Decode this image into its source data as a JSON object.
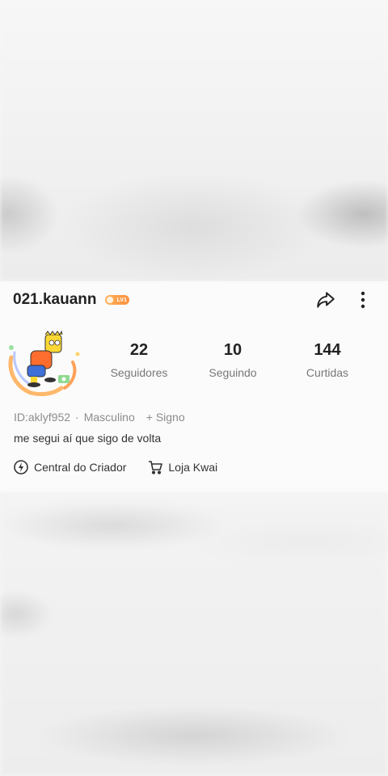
{
  "profile": {
    "username": "021.kauann",
    "level_badge": "LV1",
    "id_text": "ID:aklyf952",
    "id_separator": "·",
    "gender": "Masculino",
    "sign_action": "+ Signo",
    "bio": "me segui aí que sigo de volta"
  },
  "stats": [
    {
      "value": "22",
      "label": "Seguidores"
    },
    {
      "value": "10",
      "label": "Seguindo"
    },
    {
      "value": "144",
      "label": "Curtidas"
    }
  ],
  "links": [
    {
      "label": "Central do Criador",
      "icon": "lightning-icon"
    },
    {
      "label": "Loja Kwai",
      "icon": "cart-icon"
    }
  ],
  "header_icons": {
    "share": "share-icon",
    "more": "more-vertical-icon"
  },
  "colors": {
    "badge": "#ff8f3a",
    "text_primary": "#222222",
    "text_secondary": "#8c8c8c"
  }
}
